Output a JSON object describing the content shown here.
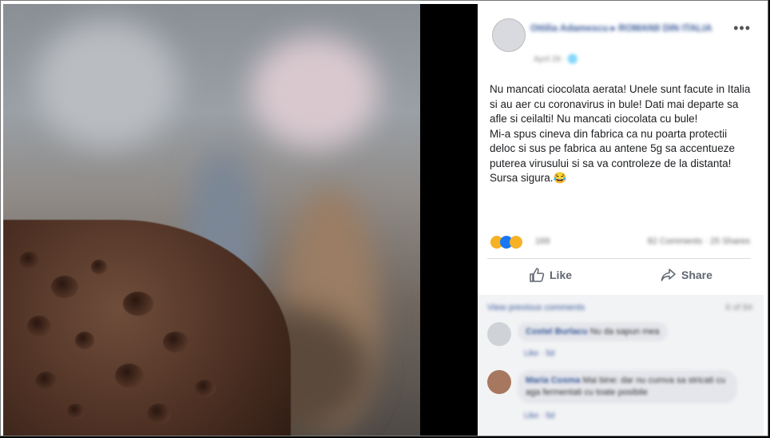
{
  "author": {
    "name": "Ottilia Adamescu ▸ ROMANII DIN ITALIA",
    "time": "April 28 · 🌐"
  },
  "menu": {
    "more_label": "•••"
  },
  "post": {
    "text": "Nu mancati ciocolata aerata! Unele sunt facute in Italia si au aer cu coronavirus in bule! Dati mai departe sa afle si ceilalti! Nu mancati ciocolata cu bule!\nMi-a spus cineva din fabrica ca nu poarta protectii deloc si sus pe fabrica au antene 5g sa accentueze puterea virusului si sa va controleze de la distanta! Sursa sigura.😂"
  },
  "reactions": {
    "count": "169",
    "summary": "82 Comments · 25 Shares"
  },
  "actions": {
    "like_label": "Like",
    "share_label": "Share"
  },
  "comments": {
    "view_previous": "View previous comments",
    "position": "6 of 84",
    "items": [
      {
        "author": "Costel Burlacu",
        "text": "Nu da sapun mea",
        "meta": "Like · 5d"
      },
      {
        "author": "Maria Cosma",
        "text": "Mai bine: dar nu cumva sa stricati cu aga fermentati cu toate posibile",
        "meta": "Like · 5d"
      }
    ]
  },
  "colors": {
    "link": "#385898",
    "text": "#1c1e21",
    "muted": "#606770"
  }
}
